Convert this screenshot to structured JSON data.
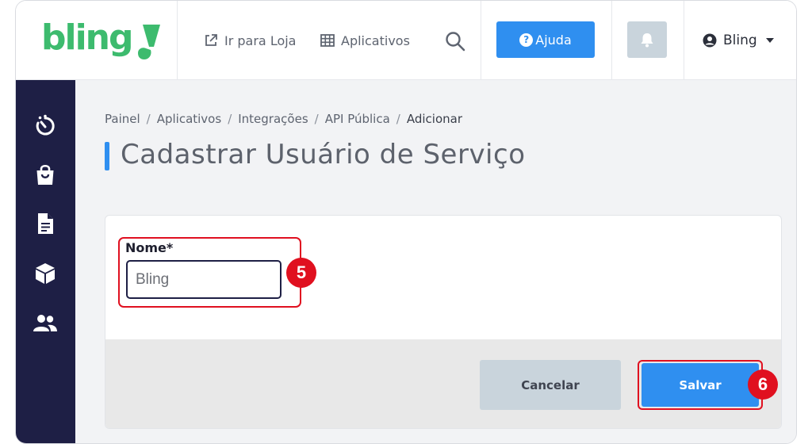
{
  "brand": {
    "logo_text": "bling",
    "color": "#3dbb6e"
  },
  "topbar": {
    "store_link": "Ir para Loja",
    "apps_link": "Aplicativos",
    "help_label": "Ajuda",
    "help_icon_char": "?",
    "user_name": "Bling"
  },
  "sidebar": {
    "items": [
      {
        "icon": "timer-icon"
      },
      {
        "icon": "shopping-bag-icon"
      },
      {
        "icon": "document-icon"
      },
      {
        "icon": "box-icon"
      },
      {
        "icon": "users-icon"
      }
    ]
  },
  "breadcrumb": {
    "items": [
      "Painel",
      "Aplicativos",
      "Integrações",
      "API Pública",
      "Adicionar"
    ],
    "separator": "/"
  },
  "page": {
    "title": "Cadastrar Usuário de Serviço"
  },
  "form": {
    "name_label": "Nome*",
    "name_placeholder": "Bling",
    "name_value": ""
  },
  "actions": {
    "cancel_label": "Cancelar",
    "save_label": "Salvar"
  },
  "annotations": {
    "step_name": "5",
    "step_save": "6"
  },
  "colors": {
    "accent": "#2f8ff0",
    "sidebar": "#1e1f45",
    "annotation": "#e0101f",
    "muted_button": "#c9d4dc"
  }
}
